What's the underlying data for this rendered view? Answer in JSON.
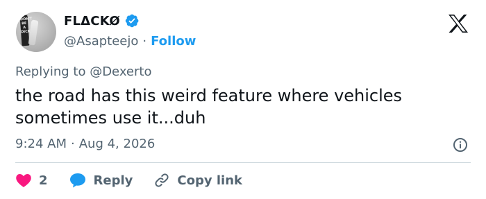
{
  "author": {
    "display_name": "FLΔCKØ",
    "handle": "@Asapteejo",
    "follow_label": "Follow",
    "separator": "·",
    "avatar_sticker_text": "DON'T BE A DICK"
  },
  "reply": {
    "text": "Replying to @Dexerto"
  },
  "tweet": {
    "text": "the road has this weird feature where vehicles sometimes use it...duh"
  },
  "meta": {
    "time": "9:24 AM",
    "separator": "·",
    "date": "Aug 4, 2026"
  },
  "actions": {
    "like_count": "2",
    "reply_label": "Reply",
    "copy_link_label": "Copy link"
  },
  "colors": {
    "accent": "#1d9bf0",
    "like": "#f91880",
    "text": "#0f1419",
    "muted": "#536471"
  },
  "icons": {
    "verified": "verified-badge-icon",
    "logo": "x-logo-icon",
    "info": "info-icon",
    "like": "heart-icon",
    "reply": "speech-bubble-icon",
    "link": "link-icon"
  }
}
